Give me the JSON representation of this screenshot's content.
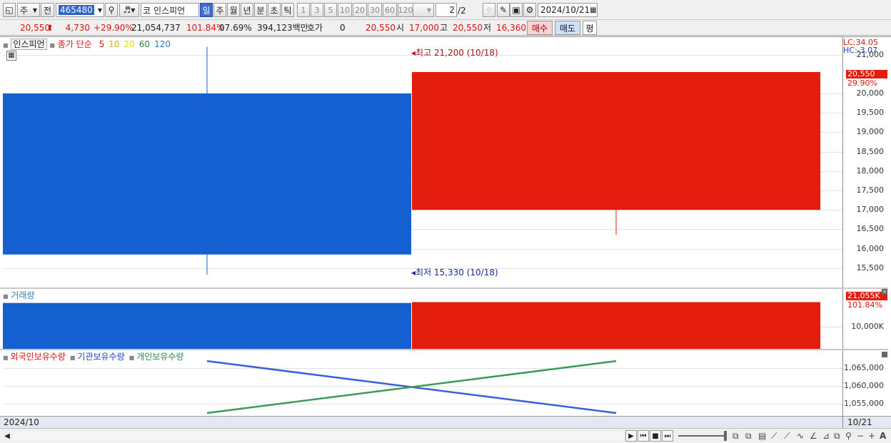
{
  "toolbar": {
    "period_main": "주",
    "prev_label": "전",
    "stock_code": "465480",
    "market_label": "코",
    "stock_name": "인스피언",
    "periods": [
      "일",
      "주",
      "월",
      "년",
      "분",
      "초",
      "틱"
    ],
    "active_period": "일",
    "intervals": [
      "1",
      "3",
      "5",
      "10",
      "20",
      "30",
      "60",
      "120"
    ],
    "page_current": "2",
    "page_total": "/2",
    "date": "2024/10/21"
  },
  "info": {
    "price": "20,550",
    "change": "4,730",
    "change_pct": "+29.90%",
    "volume": "21,054,737",
    "volume_ratio": "101.84%",
    "turnover": "07.69%",
    "amount": "394,123백만",
    "hoga_label": "호가",
    "hoga_value": "0",
    "hoga_price": "20,550",
    "open_label": "시",
    "open_value": "17,000",
    "high_label": "고",
    "high_value": "20,550",
    "low_label": "저",
    "low_value": "16,360",
    "buy_label": "매수",
    "sell_label": "매도",
    "eval_label": "평"
  },
  "price_pane": {
    "stock_tag": "인스피언",
    "legend_title": "종가 단순",
    "ma": [
      {
        "label": "5",
        "color": "#d8140f"
      },
      {
        "label": "10",
        "color": "#e0b400"
      },
      {
        "label": "20",
        "color": "#e8e000"
      },
      {
        "label": "60",
        "color": "#2a8a2a"
      },
      {
        "label": "120",
        "color": "#2a7fb0"
      }
    ],
    "lc_label": "LC:34.05",
    "hc_label": "HC:-3.07",
    "high_annotation": "최고 21,200 (10/18)",
    "low_annotation": "최저 15,330 (10/18)",
    "current_price_tag": "20,550",
    "current_pct_tag": "29.90%",
    "ticks": [
      "21,000",
      "20,000",
      "19,500",
      "19,000",
      "18,500",
      "18,000",
      "17,500",
      "17,000",
      "16,500",
      "16,000",
      "15,500"
    ]
  },
  "volume_pane": {
    "legend": "거래량",
    "current_tag": "21,055K",
    "current_pct": "101.84%",
    "ticks": [
      "10,000K"
    ]
  },
  "holding_pane": {
    "legend": [
      "외국인보유수량",
      "기관보유수량",
      "개인보유수량"
    ],
    "legend_colors": [
      "#d8140f",
      "#1a44c9",
      "#2a8a50"
    ],
    "ticks": [
      "1,065,000",
      "1,060,000",
      "1,055,000"
    ]
  },
  "datebar": {
    "left": "2024/10",
    "right": "10/21"
  },
  "chart_data": {
    "type": "candlestick",
    "candles": [
      {
        "date": "10/18",
        "open": 20000,
        "close": 15850,
        "high": 21200,
        "low": 15330,
        "volume": 20673000,
        "color": "#1560d0"
      },
      {
        "date": "10/21",
        "open": 17000,
        "close": 20550,
        "high": 20550,
        "low": 16360,
        "volume": 21055000,
        "color": "#e41c0e"
      }
    ],
    "holdings": [
      {
        "name": "기관보유수량",
        "values": [
          1067000,
          1052500
        ],
        "color": "#3a60d8"
      },
      {
        "name": "개인보유수량",
        "values": [
          1052500,
          1067000
        ],
        "color": "#3a9a5a"
      }
    ],
    "price_ylim": [
      15000,
      21450
    ],
    "volume_ylim": [
      0,
      27000000
    ],
    "holding_ylim": [
      1051500,
      1070000
    ]
  }
}
